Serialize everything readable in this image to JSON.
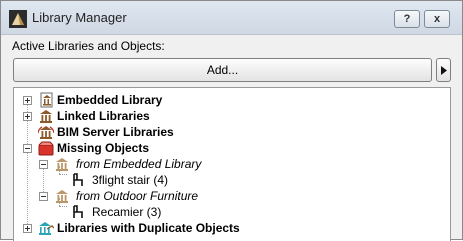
{
  "window": {
    "title": "Library Manager",
    "help_label": "?",
    "close_label": "x"
  },
  "active_label": "Active Libraries and Objects:",
  "add_button": "Add...",
  "tree": {
    "embedded": "Embedded Library",
    "linked": "Linked Libraries",
    "bim_server": "BIM Server Libraries",
    "missing": "Missing Objects",
    "from_embedded": "from Embedded Library",
    "stair": "3flight stair (4)",
    "from_outdoor": "from Outdoor Furniture",
    "recamier": "Recamier (3)",
    "duplicates": "Libraries with Duplicate Objects"
  },
  "colors": {
    "missing_icon": "#d9342b",
    "library_icon": "#8b5a2b",
    "duplicates_icon": "#2aa6b8"
  }
}
